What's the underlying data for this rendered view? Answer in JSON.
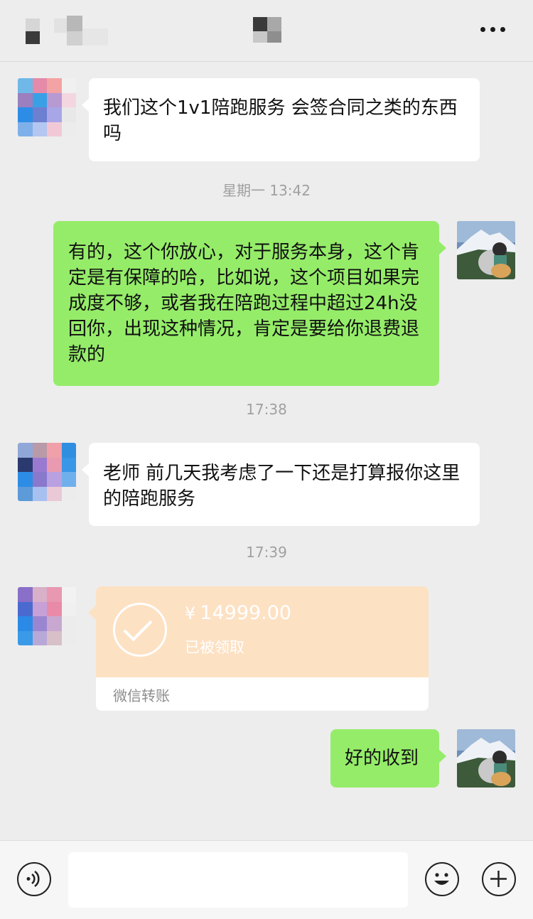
{
  "header": {
    "contact_name_pixelated": true,
    "more_icon": "more-dots-icon"
  },
  "messages": [
    {
      "id": "m1",
      "side": "left",
      "type": "text",
      "text": "我们这个1v1陪跑服务 会签合同之类的东西吗"
    },
    {
      "id": "t1",
      "type": "timestamp",
      "text": "星期一 13:42"
    },
    {
      "id": "m2",
      "side": "right",
      "type": "text",
      "text": "有的，这个你放心，对于服务本身，这个肯定是有保障的哈，比如说，这个项目如果完成度不够，或者我在陪跑过程中超过24h没回你，出现这种情况，肯定是要给你退费退款的"
    },
    {
      "id": "t2",
      "type": "timestamp",
      "text": "17:38"
    },
    {
      "id": "m3",
      "side": "left",
      "type": "text",
      "text": "老师 前几天我考虑了一下还是打算报你这里的陪跑服务"
    },
    {
      "id": "t3",
      "type": "timestamp",
      "text": "17:39"
    },
    {
      "id": "m4",
      "side": "left",
      "type": "transfer",
      "currency": "¥",
      "amount": "14999.00",
      "status": "已被领取",
      "label": "微信转账"
    },
    {
      "id": "m5",
      "side": "right",
      "type": "text",
      "text": "好的收到"
    }
  ],
  "input_bar": {
    "voice_icon": "voice-icon",
    "input_value": "",
    "emoji_icon": "emoji-icon",
    "plus_icon": "plus-icon"
  },
  "colors": {
    "background": "#ededed",
    "bubble_self": "#95ec69",
    "bubble_other": "#ffffff",
    "transfer_card": "#fde1c3",
    "timestamp_text": "#a0a0a0"
  }
}
